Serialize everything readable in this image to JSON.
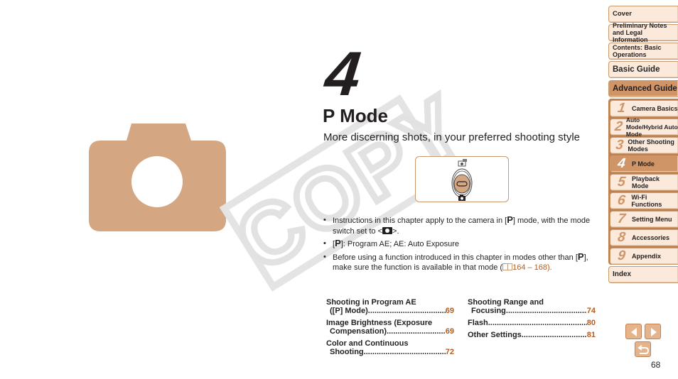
{
  "chapter": {
    "number": "4",
    "title": "P Mode",
    "subtitle": "More discerning shots, in your preferred shooting style"
  },
  "watermark": {
    "text": "COPY"
  },
  "bullets": [
    {
      "parts": [
        "Instructions in this chapter apply to the camera in [",
        "P",
        "] mode, with the mode switch set to <",
        "camera-icon",
        ">."
      ]
    },
    {
      "parts": [
        "[",
        "P",
        "]: Program AE; AE: Auto Exposure"
      ]
    },
    {
      "parts": [
        "Before using a function introduced in this chapter in modes other than [",
        "P",
        "], make sure the function is available in that mode (",
        "164 – 168",
        ")."
      ]
    }
  ],
  "toc": {
    "col1": [
      {
        "line1": "Shooting in Program AE",
        "line2": "([P] Mode)",
        "page": "69"
      },
      {
        "line1": "Image Brightness (Exposure",
        "line2": "Compensation)",
        "page": "69"
      },
      {
        "line1": "Color and Continuous",
        "line2": "Shooting",
        "page": "72"
      }
    ],
    "col2": [
      {
        "line1": "Shooting Range and",
        "line2": "Focusing",
        "page": "74"
      },
      {
        "line1": "",
        "line2": "Flash",
        "page": "80"
      },
      {
        "line1": "",
        "line2": "Other Settings",
        "page": "81"
      }
    ]
  },
  "sidebar": {
    "top": [
      {
        "label": "Cover"
      },
      {
        "label": "Preliminary Notes and Legal Information"
      },
      {
        "label": "Contents: Basic Operations"
      },
      {
        "label": "Basic Guide"
      }
    ],
    "advanced": {
      "label": "Advanced Guide"
    },
    "chapters": [
      {
        "num": "1",
        "label": "Camera Basics",
        "active": false
      },
      {
        "num": "2",
        "label": "Auto Mode/Hybrid Auto Mode",
        "active": false
      },
      {
        "num": "3",
        "label": "Other Shooting Modes",
        "active": false
      },
      {
        "num": "4",
        "label": "P Mode",
        "active": true
      },
      {
        "num": "5",
        "label": "Playback Mode",
        "active": false
      },
      {
        "num": "6",
        "label": "Wi-Fi Functions",
        "active": false
      },
      {
        "num": "7",
        "label": "Setting Menu",
        "active": false
      },
      {
        "num": "8",
        "label": "Accessories",
        "active": false
      },
      {
        "num": "9",
        "label": "Appendix",
        "active": false
      }
    ],
    "index": {
      "label": "Index"
    }
  },
  "navigation": {
    "prev_icon": "triangle-left",
    "next_icon": "triangle-right",
    "return_icon": "return-arrow"
  },
  "page_number": "68",
  "colors": {
    "accent": "#cf9566",
    "link": "#b35c1e",
    "nav_bg": "#fbeadb"
  }
}
